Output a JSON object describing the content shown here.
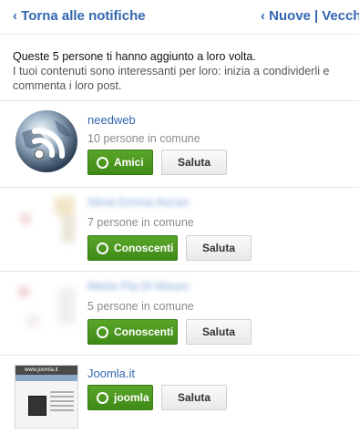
{
  "header": {
    "back_label": "‹ Torna alle notifiche",
    "new_label": "‹ Nuove",
    "separator": "|",
    "old_label": "Vecchie"
  },
  "intro": {
    "line1": "Queste 5 persone ti hanno aggiunto a loro volta.",
    "line2": "I tuoi contenuti sono interessanti per loro: inizia a condividerli e commenta i loro post."
  },
  "people": [
    {
      "name": "needweb",
      "mutual": "10 persone in comune",
      "circle_label": "Amici",
      "greet_label": "Saluta",
      "avatar_icon": "rss-globe-icon"
    },
    {
      "name": "Silvia Emma Ascari",
      "mutual": "7 persone in comune",
      "circle_label": "Conoscenti",
      "greet_label": "Saluta",
      "avatar_icon": "blurred-avatar"
    },
    {
      "name": "Maria Pia Di Mauro",
      "mutual": "5 persone in comune",
      "circle_label": "Conoscenti",
      "greet_label": "Saluta",
      "avatar_icon": "blurred-avatar"
    },
    {
      "name": "Joomla.it",
      "mutual": "",
      "circle_label": "joomla",
      "greet_label": "Saluta",
      "avatar_icon": "joomla-site-thumbnail",
      "avatar_text": "www.joomla.it"
    }
  ],
  "colors": {
    "link": "#3366b0",
    "green_button": "#4a9a1f",
    "muted_text": "#8a8a8a"
  }
}
